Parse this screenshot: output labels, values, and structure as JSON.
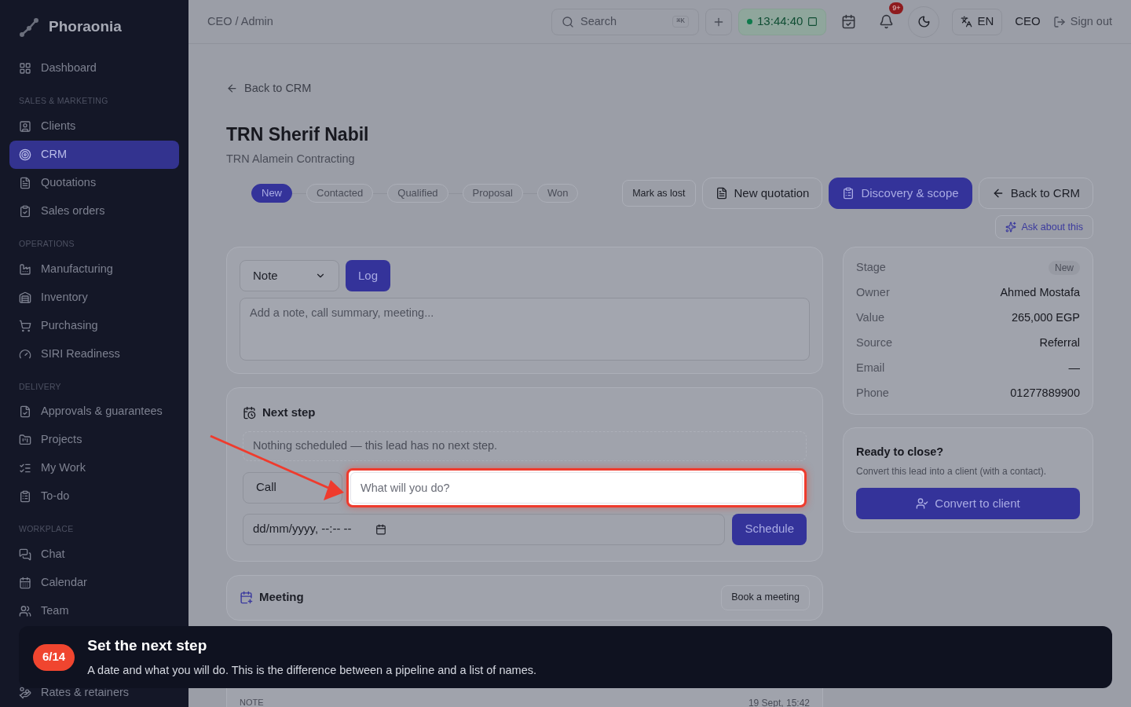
{
  "brand": {
    "name": "Phoraonia"
  },
  "sidebar": {
    "groups": [
      {
        "items": [
          {
            "label": "Dashboard",
            "selected": false
          }
        ]
      },
      {
        "title": "SALES & MARKETING",
        "items": [
          {
            "label": "Clients",
            "selected": false
          },
          {
            "label": "CRM",
            "selected": true
          },
          {
            "label": "Quotations",
            "selected": false
          },
          {
            "label": "Sales orders",
            "selected": false
          }
        ]
      },
      {
        "title": "OPERATIONS",
        "items": [
          {
            "label": "Manufacturing",
            "selected": false
          },
          {
            "label": "Inventory",
            "selected": false
          },
          {
            "label": "Purchasing",
            "selected": false
          },
          {
            "label": "SIRI Readiness",
            "selected": false
          }
        ]
      },
      {
        "title": "DELIVERY",
        "items": [
          {
            "label": "Approvals & guarantees",
            "selected": false
          },
          {
            "label": "Projects",
            "selected": false
          },
          {
            "label": "My Work",
            "selected": false
          },
          {
            "label": "To-do",
            "selected": false
          }
        ]
      },
      {
        "title": "WORKPLACE",
        "items": [
          {
            "label": "Chat",
            "selected": false
          },
          {
            "label": "Calendar",
            "selected": false
          },
          {
            "label": "Team",
            "selected": false
          },
          {
            "label": "Rates & retainers",
            "selected": false
          }
        ]
      }
    ]
  },
  "topbar": {
    "breadcrumb": "CEO / Admin",
    "search": {
      "placeholder": "Search",
      "shortcut": "⌘K"
    },
    "clock": "13:44:40",
    "notifications": "9+",
    "language": "EN",
    "role": "CEO",
    "sign_out": "Sign out"
  },
  "lead": {
    "back": "Back to CRM",
    "title": "TRN Sherif Nabil",
    "company": "TRN Alamein Contracting",
    "stages": [
      {
        "label": "New",
        "selected": true
      },
      {
        "label": "Contacted",
        "selected": false
      },
      {
        "label": "Qualified",
        "selected": false
      },
      {
        "label": "Proposal",
        "selected": false
      },
      {
        "label": "Won",
        "selected": false
      }
    ],
    "actions": [
      {
        "label": "Mark as lost",
        "kind": "small"
      },
      {
        "label": "New quotation",
        "kind": "doc"
      },
      {
        "label": "Discovery & scope",
        "kind": "primary"
      },
      {
        "label": "Back to CRM",
        "kind": "back"
      }
    ],
    "ask": "Ask about this"
  },
  "log": {
    "type": "Note",
    "button": "Log",
    "placeholder": "Add a note, call summary, meeting..."
  },
  "next_step": {
    "title": "Next step",
    "empty": "Nothing scheduled — this lead has no next step.",
    "type": "Call",
    "placeholder": "What will you do?",
    "date_placeholder": "dd/mm/yyyy, --:-- --",
    "button": "Schedule"
  },
  "meeting": {
    "title": "Meeting",
    "button": "Book a meeting"
  },
  "activity": [
    {
      "type": "NOTE",
      "time": "19 Sept, 15:42"
    }
  ],
  "details": [
    {
      "label": "Stage",
      "value": "New",
      "kind": "badge"
    },
    {
      "label": "Owner",
      "value": "Ahmed Mostafa",
      "kind": "text"
    },
    {
      "label": "Value",
      "value": "265,000 EGP",
      "kind": "text"
    },
    {
      "label": "Source",
      "value": "Referral",
      "kind": "text"
    },
    {
      "label": "Email",
      "value": "—",
      "kind": "text"
    },
    {
      "label": "Phone",
      "value": "01277889900",
      "kind": "text"
    }
  ],
  "close": {
    "title": "Ready to close?",
    "text": "Convert this lead into a client (with a contact).",
    "button": "Convert to client"
  },
  "tour": {
    "step": "6/14",
    "title": "Set the next step",
    "text": "A date and what you will do. This is the difference between a pipeline and a list of names."
  }
}
